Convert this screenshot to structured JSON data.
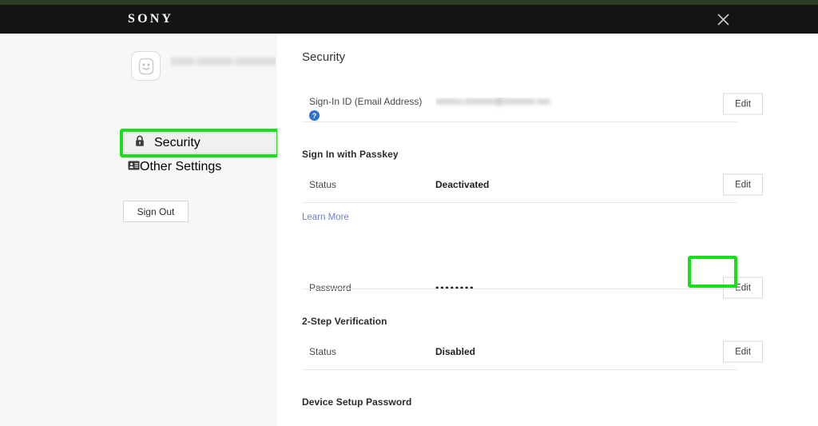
{
  "header": {
    "brand": "SONY",
    "close_label": "Close",
    "close_icon": "close-icon"
  },
  "theme": {
    "header_bg": "#141414",
    "top_strip": "#2f3c28",
    "sidebar_bg": "#f7f7f7",
    "highlight_green": "#16e016",
    "link_blue": "#6f7fd0",
    "help_blue": "#2f6fd0"
  },
  "sidebar": {
    "avatar_icon": "smiley-avatar-icon",
    "username_masked": "xxxxx-xxxxxxx-xxxxxxxxxxx x",
    "items": [
      {
        "label": "Security",
        "icon": "lock-icon",
        "selected": true
      },
      {
        "label": "Other Settings",
        "icon": "id-card-icon",
        "selected": false
      }
    ],
    "sign_out_label": "Sign Out"
  },
  "main": {
    "page_title": "Security",
    "sections": [
      {
        "id": "sign-in-id",
        "title": "",
        "rows": [
          {
            "label": "Sign-In ID (Email Address)",
            "help_icon": "help-icon",
            "help_glyph": "?",
            "value_masked": "xxxxxx.xxxxxxx@xxxxxxx.xxx",
            "value_type": "blurred-email",
            "action_label": "Edit"
          }
        ]
      },
      {
        "id": "passkey",
        "title": "Sign In with Passkey",
        "rows": [
          {
            "label": "Status",
            "value": "Deactivated",
            "value_type": "text",
            "action_label": "Edit"
          }
        ],
        "link_label": "Learn More"
      },
      {
        "id": "password",
        "title": "",
        "rows": [
          {
            "label": "Password",
            "value": "••••••••",
            "value_type": "masked-password",
            "action_label": "Edit",
            "highlighted": true
          }
        ]
      },
      {
        "id": "two-step",
        "title": "2-Step Verification",
        "rows": [
          {
            "label": "Status",
            "value": "Disabled",
            "value_type": "text",
            "action_label": "Edit"
          }
        ]
      },
      {
        "id": "device-setup-password",
        "title": "Device Setup Password",
        "rows": []
      }
    ]
  }
}
